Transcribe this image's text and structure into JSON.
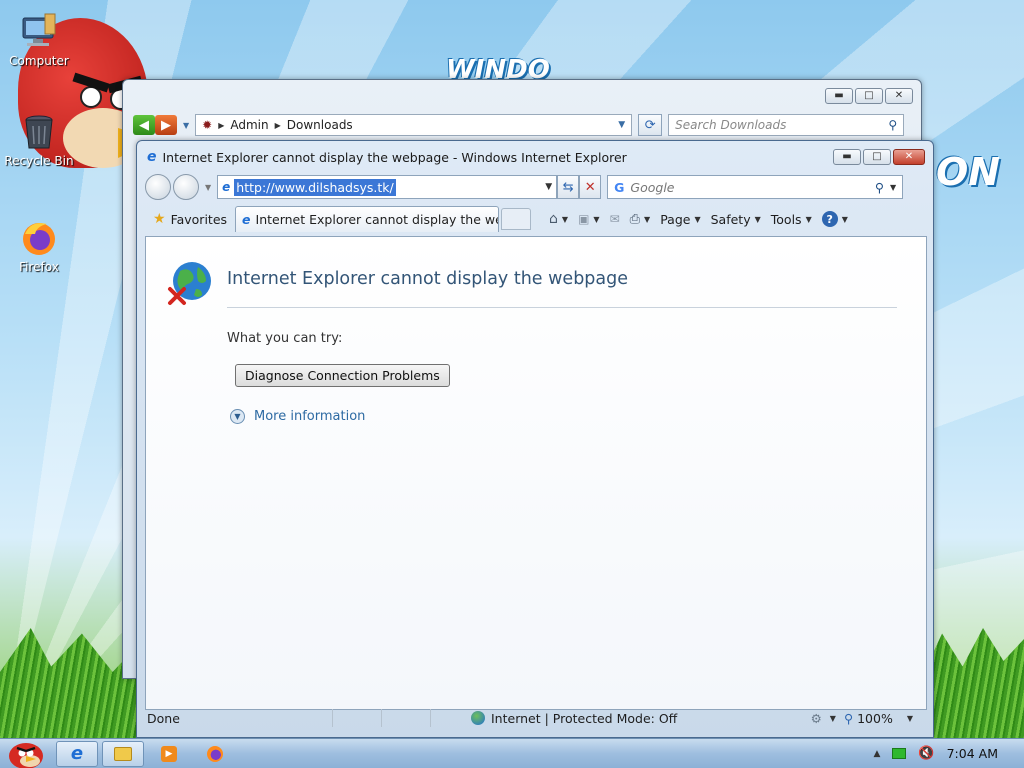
{
  "desktop": {
    "icons": [
      {
        "label": "Computer",
        "icon": "computer-icon"
      },
      {
        "label": "Recycle Bin",
        "icon": "recycle-bin-icon"
      },
      {
        "label": "Firefox",
        "icon": "firefox-icon"
      }
    ],
    "wallpaper_text_1": "WINDO",
    "wallpaper_text_2": "ON"
  },
  "explorer": {
    "breadcrumb": [
      "Admin",
      "Downloads"
    ],
    "search_placeholder": "Search Downloads"
  },
  "ie": {
    "window_title": "Internet Explorer cannot display the webpage - Windows Internet Explorer",
    "address_url": "http://www.dilshadsys.tk/",
    "search_placeholder": "Google",
    "favorites_label": "Favorites",
    "tab_title": "Internet Explorer cannot display the we...",
    "commands": {
      "page": "Page",
      "safety": "Safety",
      "tools": "Tools"
    },
    "content": {
      "heading": "Internet Explorer cannot display the webpage",
      "what_you_can_try": "What you can try:",
      "diagnose_button": "Diagnose Connection Problems",
      "more_information": "More information"
    },
    "status": {
      "left": "Done",
      "zone": "Internet | Protected Mode: Off",
      "zoom": "100%"
    }
  },
  "taskbar": {
    "clock": "7:04 AM"
  },
  "colors": {
    "accent_blue": "#2d6aa3",
    "url_highlight": "#3b77d6",
    "close_red": "#c3402c"
  }
}
